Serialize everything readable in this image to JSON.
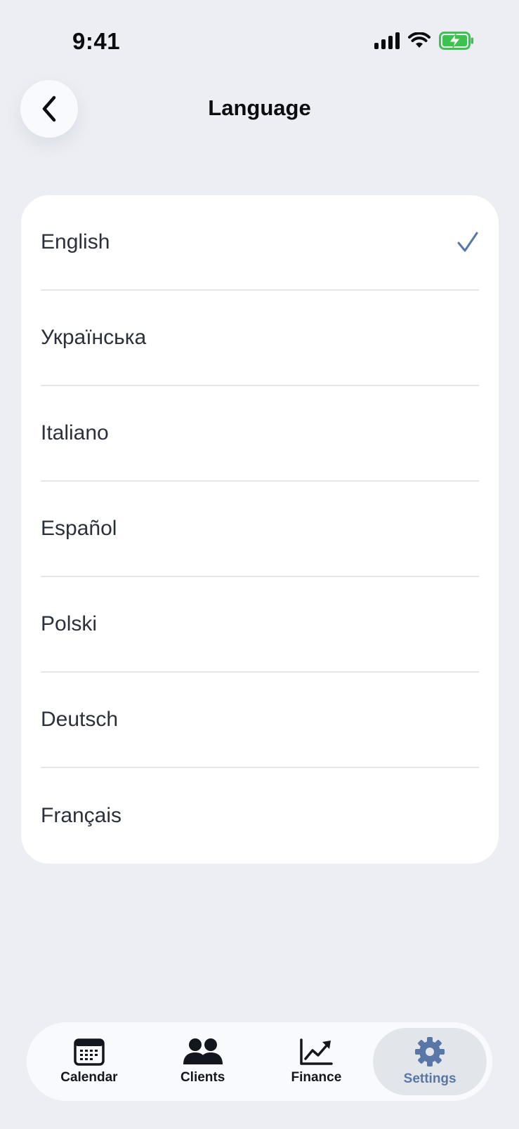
{
  "status_bar": {
    "time": "9:41"
  },
  "header": {
    "title": "Language",
    "back_icon": "chevron-left-icon"
  },
  "languages": [
    {
      "label": "English",
      "selected": true
    },
    {
      "label": "Українська",
      "selected": false
    },
    {
      "label": "Italiano",
      "selected": false
    },
    {
      "label": "Español",
      "selected": false
    },
    {
      "label": "Polski",
      "selected": false
    },
    {
      "label": "Deutsch",
      "selected": false
    },
    {
      "label": "Français",
      "selected": false
    }
  ],
  "tabbar": {
    "tabs": [
      {
        "label": "Calendar",
        "icon": "calendar-icon",
        "active": false
      },
      {
        "label": "Clients",
        "icon": "users-icon",
        "active": false
      },
      {
        "label": "Finance",
        "icon": "chart-line-icon",
        "active": false
      },
      {
        "label": "Settings",
        "icon": "gear-icon",
        "active": true
      }
    ]
  },
  "colors": {
    "background": "#ECEEF3",
    "accent": "#5877A6",
    "battery_green": "#3DC24F"
  }
}
